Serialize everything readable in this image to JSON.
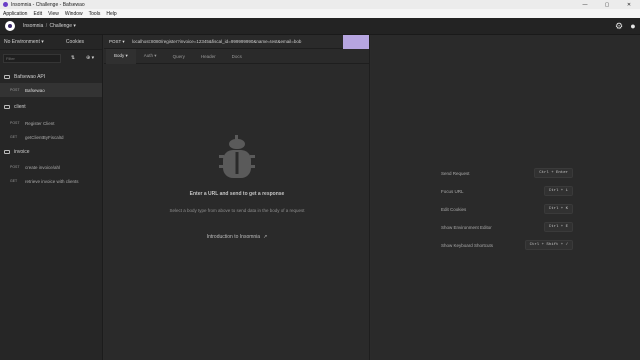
{
  "window": {
    "title": "Insomnia - Challenge - Bafsewao",
    "minimize": "—",
    "maximize": "▢",
    "close": "✕"
  },
  "menu": [
    "Application",
    "Edit",
    "View",
    "Window",
    "Tools",
    "Help"
  ],
  "header": {
    "breadcrumb_root": "Insomnia",
    "breadcrumb_sep": "/",
    "breadcrumb_current": "Challenge",
    "breadcrumb_chevron": "▾",
    "settings_icon": "⚙",
    "account_icon": "●"
  },
  "sidebar": {
    "environment": "No Environment ▾",
    "cookies": "Cookies",
    "filter_placeholder": "Filter",
    "sort_icon": "⇅",
    "add_icon": "⊕ ▾",
    "items": [
      {
        "type": "folder",
        "label": "Bafsewao API"
      },
      {
        "type": "request",
        "method": "POST",
        "label": "Bafsewao",
        "active": true
      },
      {
        "type": "folder",
        "label": "client"
      },
      {
        "type": "request",
        "method": "POST",
        "label": "Register Client",
        "active": false
      },
      {
        "type": "request",
        "method": "GET",
        "label": "getClientByFiscalId",
        "active": false
      },
      {
        "type": "folder",
        "label": "invoice"
      },
      {
        "type": "request",
        "method": "POST",
        "label": "create invoice/ahl",
        "active": false
      },
      {
        "type": "request",
        "method": "GET",
        "label": "retrieve invoice with clients",
        "active": false
      }
    ]
  },
  "request": {
    "method": "POST ▾",
    "url": "localhost:8080/register?invoice=12345&fiscal_id=999999990&name=test&email=bob",
    "tabs": [
      "Body ▾",
      "Auth ▾",
      "Query",
      "Header",
      "Docs"
    ],
    "empty_title": "Enter a URL and send to get a response",
    "empty_subtitle": "Select a body type from above to send data in the body of a request",
    "intro_link": "Introduction to Insomnia",
    "external_icon": "↗"
  },
  "response": {
    "shortcuts": [
      {
        "label": "Send Request",
        "keys": "Ctrl + Enter"
      },
      {
        "label": "Focus URL",
        "keys": "Ctrl + L"
      },
      {
        "label": "Edit Cookies",
        "keys": "Ctrl + K"
      },
      {
        "label": "Show Environment Editor",
        "keys": "Ctrl + E"
      },
      {
        "label": "Show Keyboard Shortcuts",
        "keys": "Ctrl + Shift + /"
      }
    ]
  },
  "colors": {
    "accent": "#b6a5e0",
    "background": "#2b2b2b",
    "sidebar": "#262626"
  }
}
